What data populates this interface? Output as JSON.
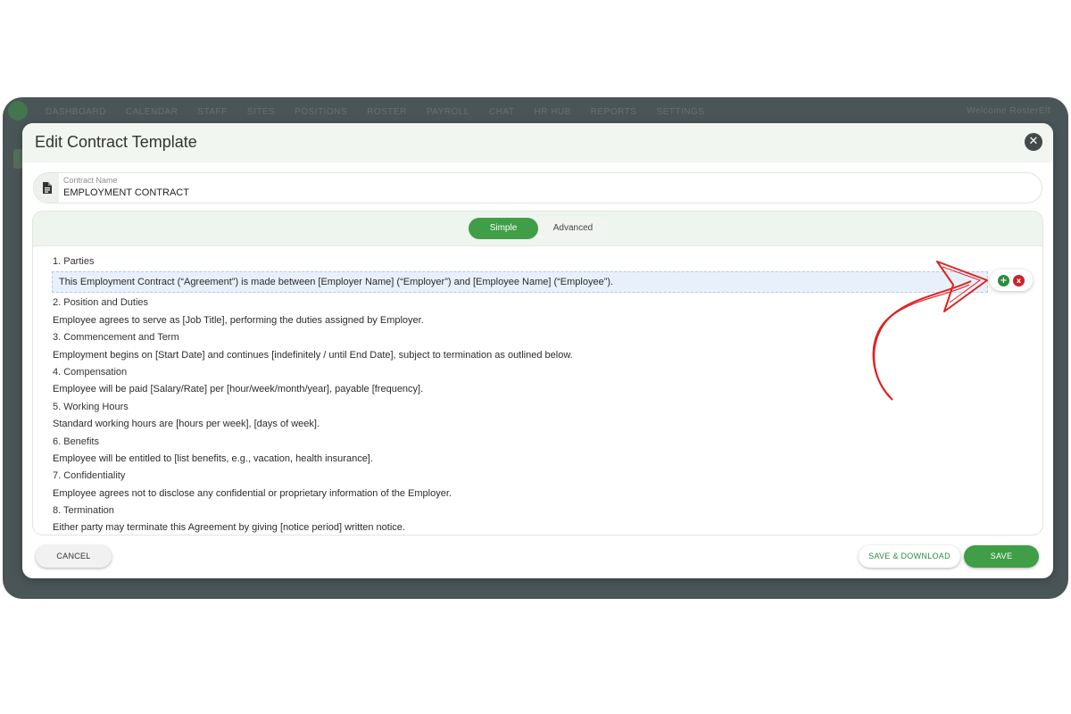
{
  "nav": {
    "items": [
      "DASHBOARD",
      "CALENDAR",
      "STAFF",
      "SITES",
      "POSITIONS",
      "ROSTER",
      "PAYROLL",
      "CHAT",
      "HR HUB",
      "REPORTS",
      "SETTINGS"
    ],
    "welcome": "Welcome RosterElf"
  },
  "modal": {
    "title": "Edit Contract Template",
    "close_icon": "close-icon"
  },
  "contract_name": {
    "label": "Contract Name",
    "value": "EMPLOYMENT CONTRACT",
    "icon": "document-icon"
  },
  "editor": {
    "mode_options": [
      "Simple",
      "Advanced"
    ],
    "active_mode": "Simple",
    "lines": [
      {
        "text": "1. Parties",
        "type": "heading"
      },
      {
        "text": "This Employment Contract (“Agreement”) is made between [Employer Name] (“Employer”) and [Employee Name] (“Employee”).",
        "type": "selected"
      },
      {
        "text": "2. Position and Duties",
        "type": "heading"
      },
      {
        "text": "Employee agrees to serve as [Job Title], performing the duties assigned by Employer.",
        "type": "body"
      },
      {
        "text": "3. Commencement and Term",
        "type": "heading"
      },
      {
        "text": "Employment begins on [Start Date] and continues [indefinitely / until End Date], subject to termination as outlined below.",
        "type": "body"
      },
      {
        "text": "4. Compensation",
        "type": "heading"
      },
      {
        "text": "Employee will be paid [Salary/Rate] per [hour/week/month/year], payable [frequency].",
        "type": "body"
      },
      {
        "text": "5. Working Hours",
        "type": "heading"
      },
      {
        "text": "Standard working hours are [hours per week], [days of week].",
        "type": "body"
      },
      {
        "text": "6. Benefits",
        "type": "heading"
      },
      {
        "text": "Employee will be entitled to [list benefits, e.g., vacation, health insurance].",
        "type": "body"
      },
      {
        "text": "7. Confidentiality",
        "type": "heading"
      },
      {
        "text": "Employee agrees not to disclose any confidential or proprietary information of the Employer.",
        "type": "body"
      },
      {
        "text": "8. Termination",
        "type": "heading"
      },
      {
        "text": "Either party may terminate this Agreement by giving [notice period] written notice.",
        "type": "body"
      }
    ],
    "row_actions": {
      "add": "+",
      "remove": "x"
    }
  },
  "footer": {
    "cancel_label": "CANCEL",
    "save_download_label": "SAVE & DOWNLOAD",
    "save_label": "SAVE"
  },
  "colors": {
    "accent": "#3f9e46",
    "danger": "#c8232c",
    "annotation": "#e02020"
  }
}
